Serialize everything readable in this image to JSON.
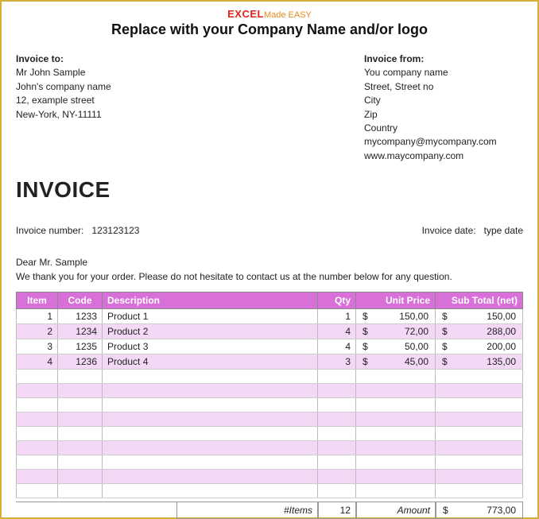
{
  "brand": {
    "excel": "EXCEL",
    "made": "Made",
    "easy": " EASY",
    "company_line": "Replace with your Company Name  and/or logo"
  },
  "invoice_to": {
    "label": "Invoice to:",
    "lines": [
      "Mr John Sample",
      "John's company name",
      "12, example street",
      "New-York, NY-11111"
    ]
  },
  "invoice_from": {
    "label": "Invoice from:",
    "lines": [
      "You company name",
      "Street, Street no",
      "City",
      "Zip",
      "Country",
      "mycompany@mycompany.com",
      "www.maycompany.com"
    ]
  },
  "title": "INVOICE",
  "meta": {
    "number_label": "Invoice number:",
    "number_value": "123123123",
    "date_label": "Invoice date:",
    "date_value": "type date"
  },
  "salutation": "Dear Mr. Sample",
  "thanks": "We thank you for your order. Please do not hesitate to contact us at the number below for any question.",
  "headers": {
    "item": "Item",
    "code": "Code",
    "desc": "Description",
    "qty": "Qty",
    "unit": "Unit Price",
    "sub": "Sub Total (net)"
  },
  "currency": "$",
  "rows": [
    {
      "item": "1",
      "code": "1233",
      "desc": "Product 1",
      "qty": "1",
      "unit": "150,00",
      "sub": "150,00"
    },
    {
      "item": "2",
      "code": "1234",
      "desc": "Product 2",
      "qty": "4",
      "unit": "72,00",
      "sub": "288,00"
    },
    {
      "item": "3",
      "code": "1235",
      "desc": "Product 3",
      "qty": "4",
      "unit": "50,00",
      "sub": "200,00"
    },
    {
      "item": "4",
      "code": "1236",
      "desc": "Product 4",
      "qty": "3",
      "unit": "45,00",
      "sub": "135,00"
    }
  ],
  "empty_rows": 9,
  "totals": {
    "items_label": "#Items",
    "items_value": "12",
    "amount_label": "Amount",
    "amount_value": "773,00"
  }
}
